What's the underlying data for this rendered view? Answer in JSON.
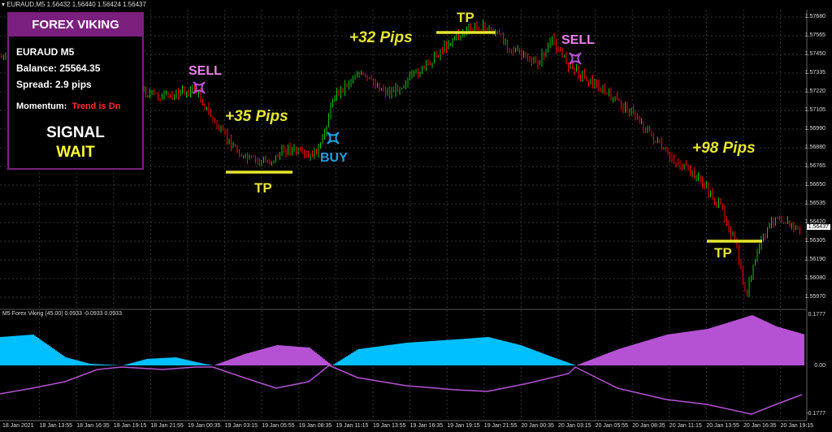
{
  "window": {
    "title": "EURAUD,M5  1.56432 1.56440 1.56424 1.56437"
  },
  "panel": {
    "brand": "FOREX VIKING",
    "symbol": "EURAUD M5",
    "balance": "Balance: 25564.35",
    "spread": "Spread: 2.9 pips",
    "momentum_label": "Momentum:",
    "momentum_value": "Trend is Dn",
    "signal_label": "SIGNAL",
    "signal_value": "WAIT"
  },
  "annotations": {
    "pips1": "+35 Pips",
    "pips2": "+32 Pips",
    "pips3": "+98 Pips",
    "tp": "TP",
    "sell": "SELL",
    "buy": "BUY"
  },
  "price_axis": [
    "1.57680",
    "1.57565",
    "1.57450",
    "1.57335",
    "1.57220",
    "1.57105",
    "1.56990",
    "1.56880",
    "1.56765",
    "1.56650",
    "1.56535",
    "1.56420",
    "1.56305",
    "1.56190",
    "1.56080",
    "1.55970"
  ],
  "current_price": "1.56437",
  "indicator": {
    "title": "M5 Forex Viking (45.00) 0.0933 -0.0933 0.0933",
    "axis_top": "0.1777",
    "axis_zero": "0.00",
    "axis_bottom": "-0.1777"
  },
  "time_axis": [
    "18 Jan 2021",
    "18 Jan 13:55",
    "18 Jan 16:35",
    "18 Jan 19:15",
    "18 Jan 21:55",
    "19 Jan 00:35",
    "19 Jan 03:15",
    "19 Jan 05:55",
    "19 Jan 08:35",
    "19 Jan 11:15",
    "19 Jan 13:55",
    "19 Jan 16:35",
    "19 Jan 19:15",
    "19 Jan 21:55",
    "20 Jan 00:35",
    "20 Jan 03:15",
    "20 Jan 05:55",
    "20 Jan 08:35",
    "20 Jan 11:15",
    "20 Jan 13:55",
    "20 Jan 16:35",
    "20 Jan 19:15"
  ],
  "colors": {
    "bull": "#00c800",
    "bear": "#ff0000",
    "tp_line": "#e6e62e",
    "hist_blue": "#00bfff",
    "hist_purple": "#b552d4",
    "panel_border": "#7b1f7f"
  }
}
